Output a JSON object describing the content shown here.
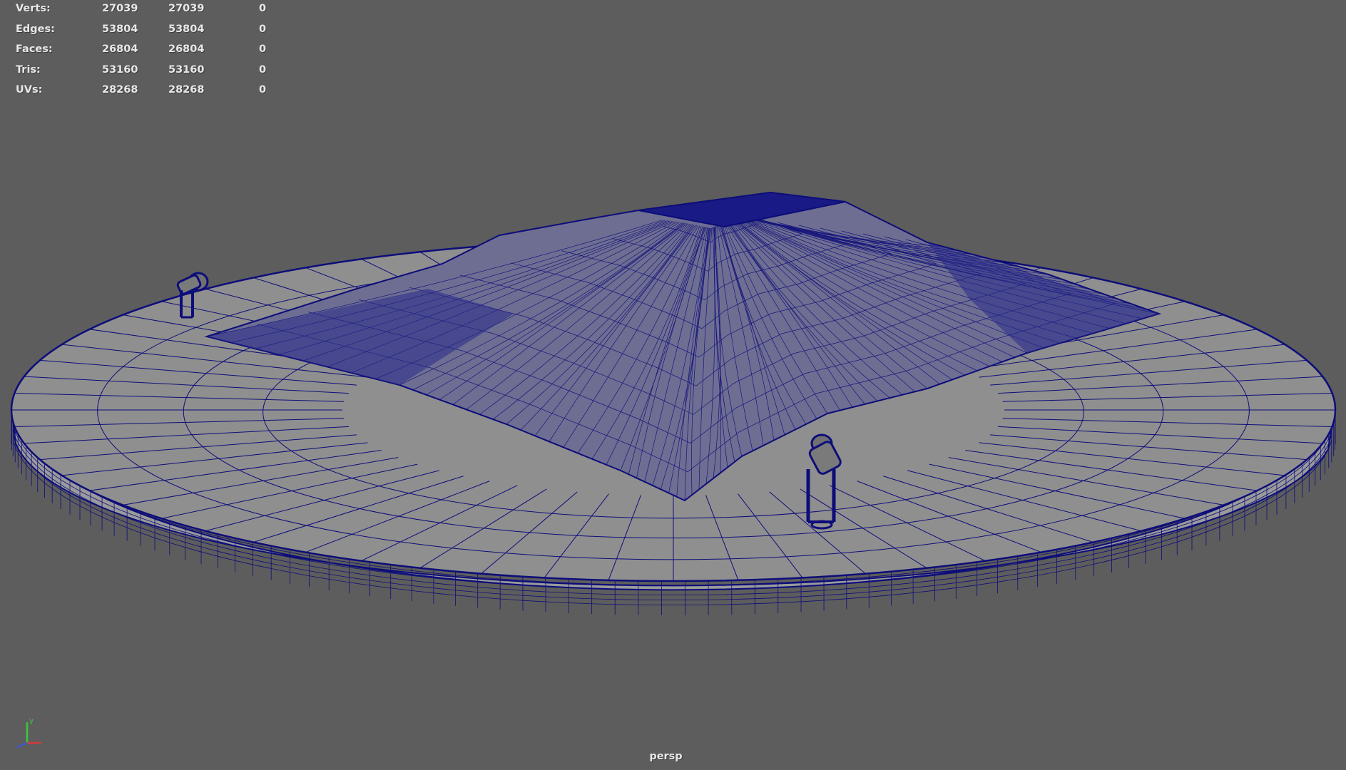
{
  "hud": {
    "rows": [
      {
        "label": "Verts:",
        "c1": "27039",
        "c2": "27039",
        "c3": "0"
      },
      {
        "label": "Edges:",
        "c1": "53804",
        "c2": "53804",
        "c3": "0"
      },
      {
        "label": "Faces:",
        "c1": "26804",
        "c2": "26804",
        "c3": "0"
      },
      {
        "label": "Tris:",
        "c1": "53160",
        "c2": "53160",
        "c3": "0"
      },
      {
        "label": "UVs:",
        "c1": "28268",
        "c2": "28268",
        "c3": "0"
      }
    ]
  },
  "viewport": {
    "camera_label": "persp",
    "background": "#5d5d5d",
    "wire_color": "#0d0d7a",
    "surface_color": "#8c8c8c"
  },
  "axis_gizmo": {
    "y_label": "y",
    "x_color": "#d23c3c",
    "y_color": "#3cc83c",
    "z_color": "#3c5ad2"
  }
}
